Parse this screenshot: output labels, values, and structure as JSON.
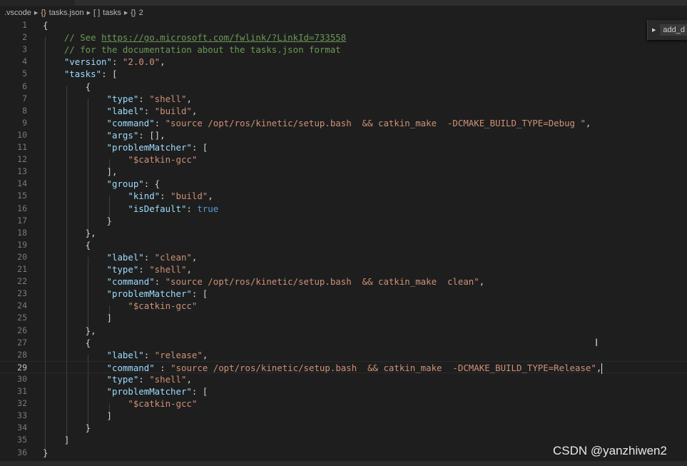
{
  "breadcrumb": {
    "items": [
      ".vscode",
      "tasks.json",
      "tasks",
      "2"
    ],
    "icons": [
      "folder",
      "json-braces-icon",
      "array-brackets-icon",
      "object-braces-icon"
    ],
    "file_icon": "{}",
    "array_icon": "[ ]",
    "object_icon": "{}"
  },
  "outline_widget": {
    "label": "add_d"
  },
  "watermark": "CSDN @yanzhiwen2",
  "editor": {
    "active_line": 29,
    "colors": {
      "key": "#9cdcfe",
      "string": "#ce9178",
      "comment": "#6a9955",
      "boolean": "#569cd6",
      "background": "#1e1e1e"
    },
    "lines": [
      [
        [
          "p",
          "{"
        ]
      ],
      [
        [
          "c",
          "    // See "
        ],
        [
          "u",
          "https://go.microsoft.com/fwlink/?LinkId=733558"
        ]
      ],
      [
        [
          "c",
          "    // for the documentation about the tasks.json format"
        ]
      ],
      [
        [
          "p",
          "    "
        ],
        [
          "k",
          "\"version\""
        ],
        [
          "p",
          ": "
        ],
        [
          "s",
          "\"2.0.0\""
        ],
        [
          "p",
          ","
        ]
      ],
      [
        [
          "p",
          "    "
        ],
        [
          "k",
          "\"tasks\""
        ],
        [
          "p",
          ": ["
        ]
      ],
      [
        [
          "p",
          "        {"
        ]
      ],
      [
        [
          "p",
          "            "
        ],
        [
          "k",
          "\"type\""
        ],
        [
          "p",
          ": "
        ],
        [
          "s",
          "\"shell\""
        ],
        [
          "p",
          ","
        ]
      ],
      [
        [
          "p",
          "            "
        ],
        [
          "k",
          "\"label\""
        ],
        [
          "p",
          ": "
        ],
        [
          "s",
          "\"build\""
        ],
        [
          "p",
          ","
        ]
      ],
      [
        [
          "p",
          "            "
        ],
        [
          "k",
          "\"command\""
        ],
        [
          "p",
          ": "
        ],
        [
          "s",
          "\"source /opt/ros/kinetic/setup.bash  && catkin_make  -DCMAKE_BUILD_TYPE=Debug \""
        ],
        [
          "p",
          ","
        ]
      ],
      [
        [
          "p",
          "            "
        ],
        [
          "k",
          "\"args\""
        ],
        [
          "p",
          ": [],"
        ]
      ],
      [
        [
          "p",
          "            "
        ],
        [
          "k",
          "\"problemMatcher\""
        ],
        [
          "p",
          ": ["
        ]
      ],
      [
        [
          "p",
          "                "
        ],
        [
          "s",
          "\"$catkin-gcc\""
        ]
      ],
      [
        [
          "p",
          "            ],"
        ]
      ],
      [
        [
          "p",
          "            "
        ],
        [
          "k",
          "\"group\""
        ],
        [
          "p",
          ": {"
        ]
      ],
      [
        [
          "p",
          "                "
        ],
        [
          "k",
          "\"kind\""
        ],
        [
          "p",
          ": "
        ],
        [
          "s",
          "\"build\""
        ],
        [
          "p",
          ","
        ]
      ],
      [
        [
          "p",
          "                "
        ],
        [
          "k",
          "\"isDefault\""
        ],
        [
          "p",
          ": "
        ],
        [
          "b",
          "true"
        ]
      ],
      [
        [
          "p",
          "            }"
        ]
      ],
      [
        [
          "p",
          "        },"
        ]
      ],
      [
        [
          "p",
          "        {"
        ]
      ],
      [
        [
          "p",
          "            "
        ],
        [
          "k",
          "\"label\""
        ],
        [
          "p",
          ": "
        ],
        [
          "s",
          "\"clean\""
        ],
        [
          "p",
          ","
        ]
      ],
      [
        [
          "p",
          "            "
        ],
        [
          "k",
          "\"type\""
        ],
        [
          "p",
          ": "
        ],
        [
          "s",
          "\"shell\""
        ],
        [
          "p",
          ","
        ]
      ],
      [
        [
          "p",
          "            "
        ],
        [
          "k",
          "\"command\""
        ],
        [
          "p",
          ": "
        ],
        [
          "s",
          "\"source /opt/ros/kinetic/setup.bash  && catkin_make  clean\""
        ],
        [
          "p",
          ","
        ]
      ],
      [
        [
          "p",
          "            "
        ],
        [
          "k",
          "\"problemMatcher\""
        ],
        [
          "p",
          ": ["
        ]
      ],
      [
        [
          "p",
          "                "
        ],
        [
          "s",
          "\"$catkin-gcc\""
        ]
      ],
      [
        [
          "p",
          "            ]"
        ]
      ],
      [
        [
          "p",
          "        },"
        ]
      ],
      [
        [
          "p",
          "        {"
        ]
      ],
      [
        [
          "p",
          "            "
        ],
        [
          "k",
          "\"label\""
        ],
        [
          "p",
          ": "
        ],
        [
          "s",
          "\"release\""
        ],
        [
          "p",
          ","
        ]
      ],
      [
        [
          "p",
          "            "
        ],
        [
          "k",
          "\"command\""
        ],
        [
          "p",
          " : "
        ],
        [
          "s",
          "\"source /opt/ros/kinetic/setup.bash  && catkin_make  -DCMAKE_BUILD_TYPE=Release\""
        ],
        [
          "p",
          ","
        ]
      ],
      [
        [
          "p",
          "            "
        ],
        [
          "k",
          "\"type\""
        ],
        [
          "p",
          ": "
        ],
        [
          "s",
          "\"shell\""
        ],
        [
          "p",
          ","
        ]
      ],
      [
        [
          "p",
          "            "
        ],
        [
          "k",
          "\"problemMatcher\""
        ],
        [
          "p",
          ": ["
        ]
      ],
      [
        [
          "p",
          "                "
        ],
        [
          "s",
          "\"$catkin-gcc\""
        ]
      ],
      [
        [
          "p",
          "            ]"
        ]
      ],
      [
        [
          "p",
          "        }"
        ]
      ],
      [
        [
          "p",
          "    ]"
        ]
      ],
      [
        [
          "p",
          "}"
        ]
      ]
    ]
  }
}
